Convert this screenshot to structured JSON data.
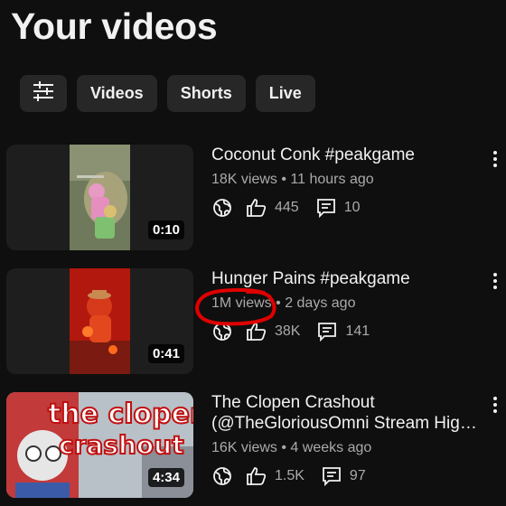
{
  "page": {
    "title": "Your videos"
  },
  "filters": {
    "filter_icon": "tune-icon",
    "chips": [
      "Videos",
      "Shorts",
      "Live"
    ]
  },
  "videos": [
    {
      "title": "Coconut Conk #peakgame",
      "views": "18K views",
      "age": "11 hours ago",
      "likes": "445",
      "comments": "10",
      "duration": "0:10"
    },
    {
      "title": "Hunger Pains #peakgame",
      "views": "1M views",
      "age": "2 days ago",
      "likes": "38K",
      "comments": "141",
      "duration": "0:41"
    },
    {
      "title_line1": "The Clopen Crashout",
      "title_line2": "(@TheGloriousOmni Stream Highli...",
      "views": "16K views",
      "age": "4 weeks ago",
      "likes": "1.5K",
      "comments": "97",
      "duration": "4:34",
      "thumb_text": [
        "the clopen",
        "crashout"
      ]
    }
  ],
  "meta_separator": "•",
  "icons": {
    "visibility": "globe-icon",
    "likes": "thumbs-up-icon",
    "comments": "comment-icon",
    "menu": "more-vert-icon"
  },
  "colors": {
    "background": "#0f0f0f",
    "chip": "#272727",
    "annotation": "#e00000",
    "secondary_text": "#aaaaaa"
  }
}
